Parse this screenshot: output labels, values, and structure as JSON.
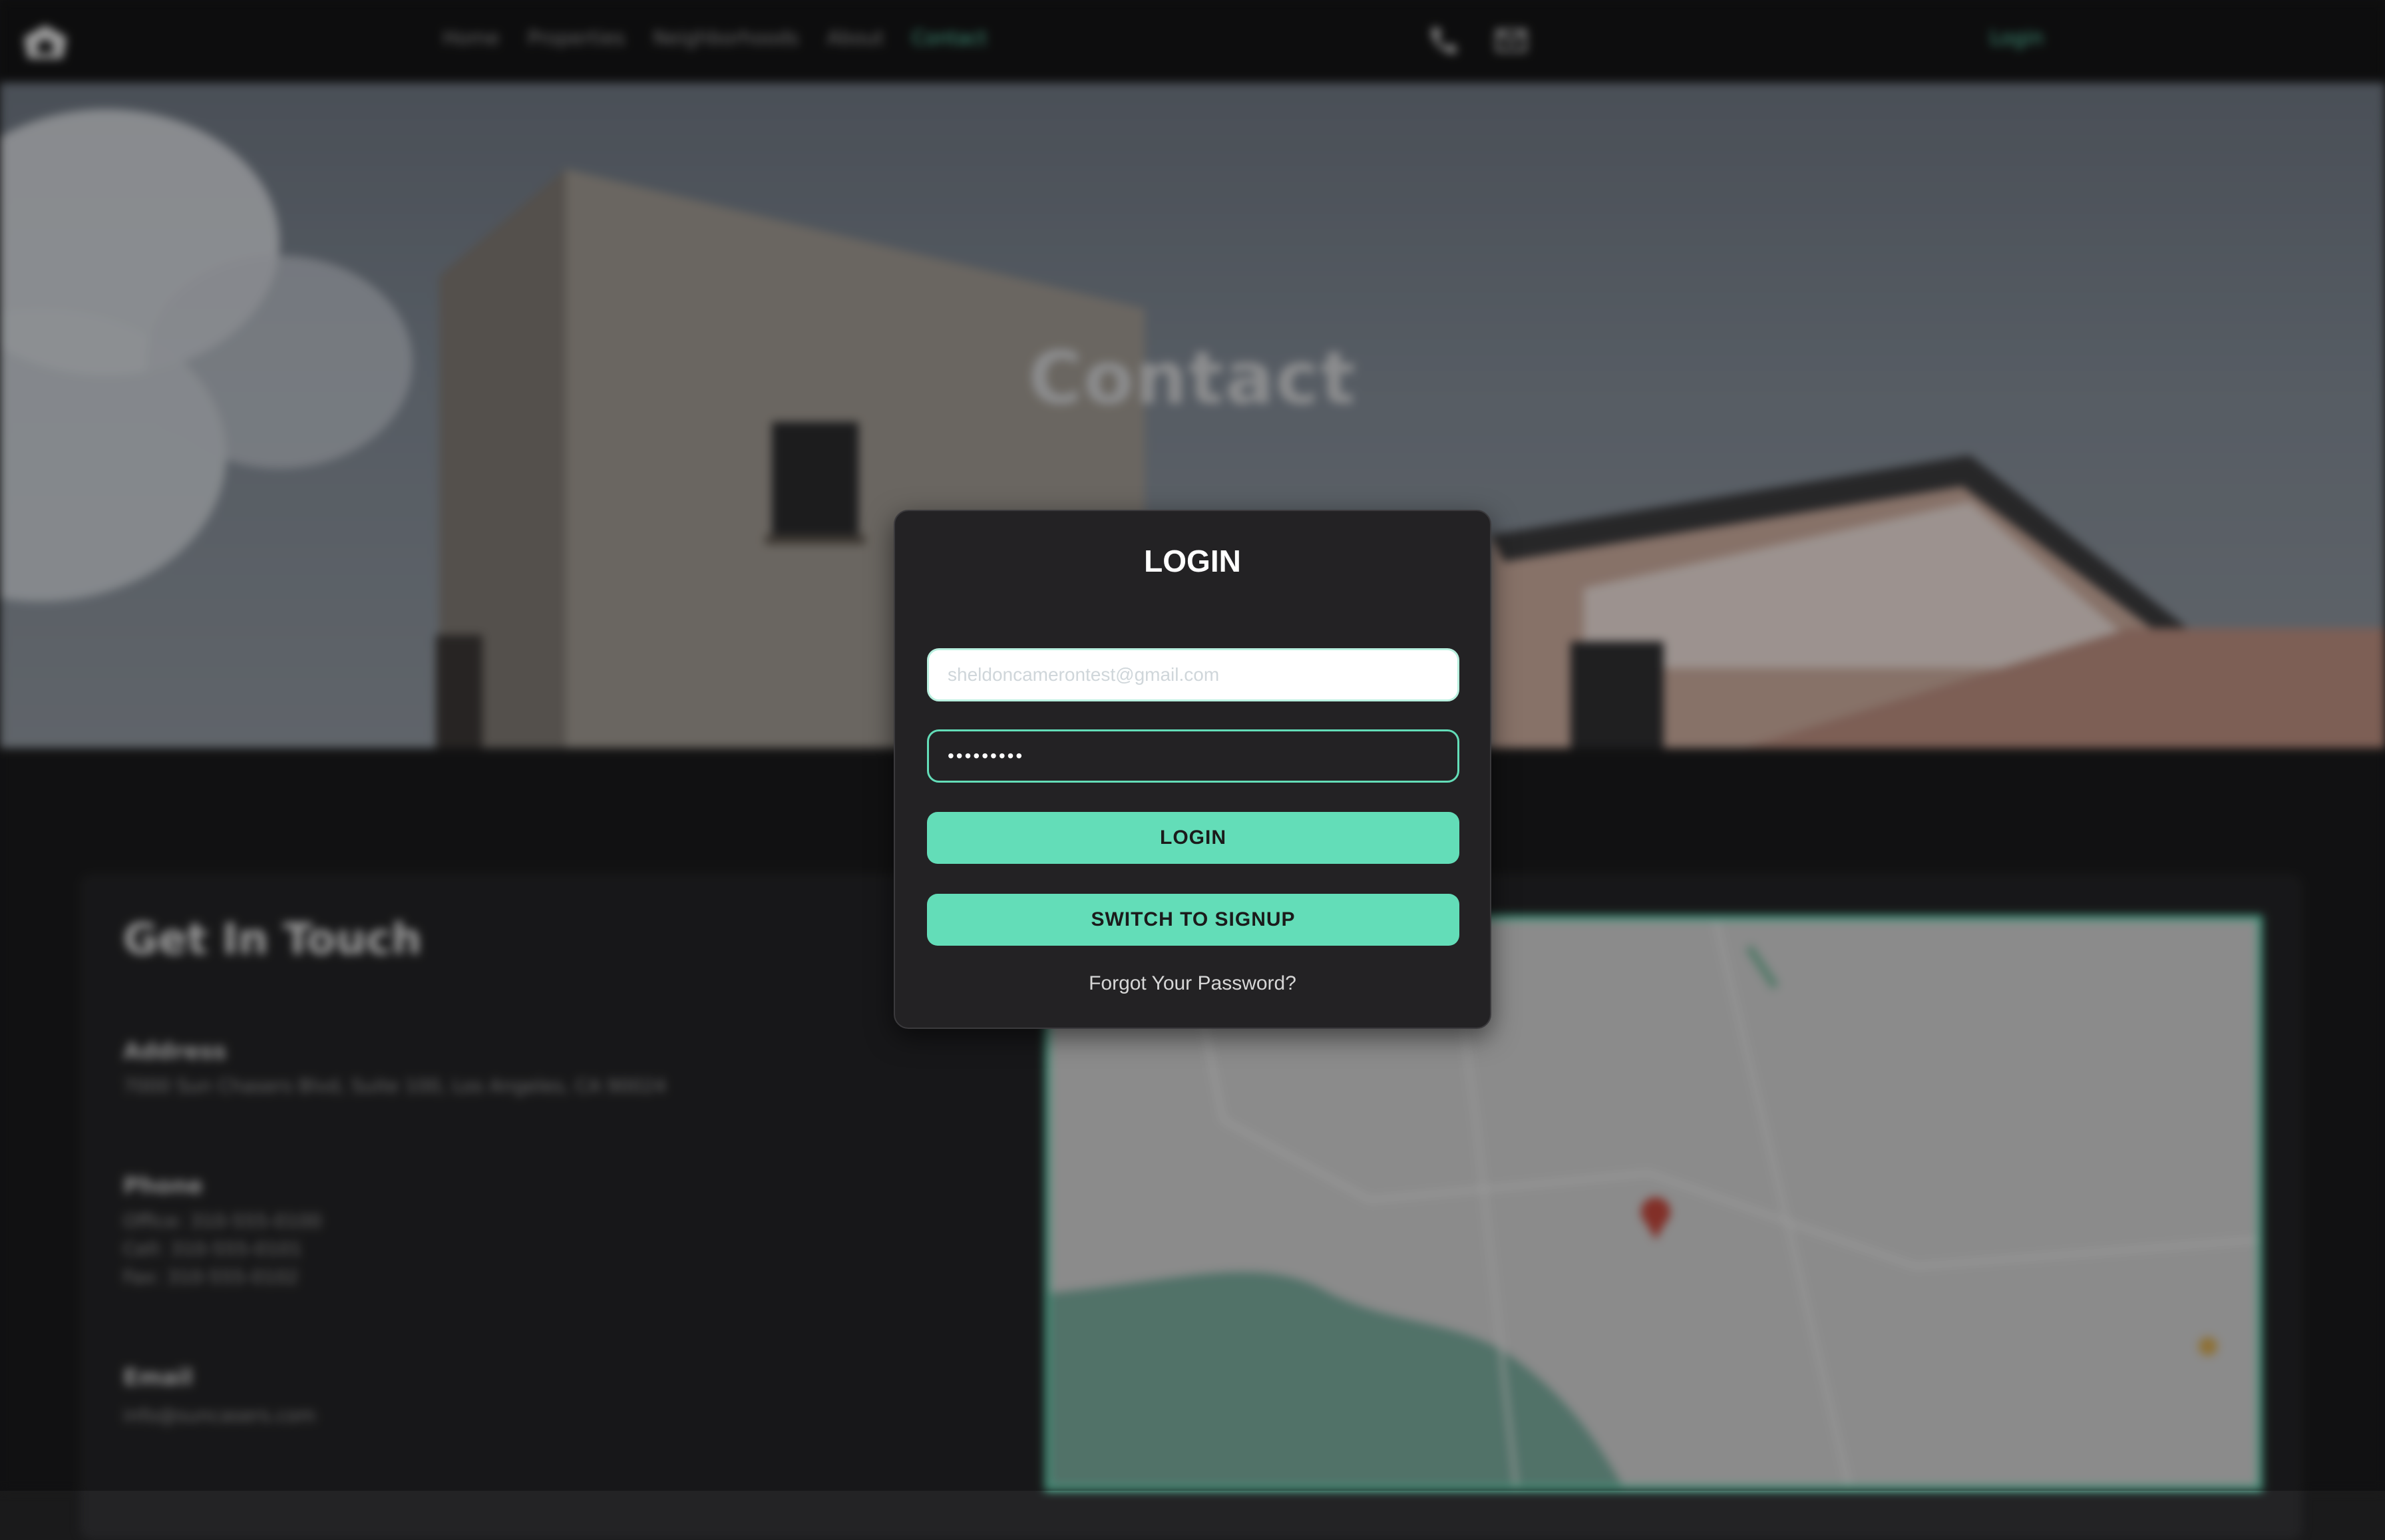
{
  "nav": {
    "links": [
      {
        "label": "Home"
      },
      {
        "label": "Properties"
      },
      {
        "label": "Neighborhoods"
      },
      {
        "label": "About"
      },
      {
        "label": "Contact"
      }
    ],
    "active_link": "Contact",
    "icons": [
      "phone-icon",
      "mail-icon"
    ],
    "login_label": "Login"
  },
  "hero": {
    "title": "Contact"
  },
  "contact": {
    "heading": "Get In Touch",
    "address_label": "Address",
    "address": "7000 Sun Chasers Blvd, Suite 100, Los Angeles, CA 90024",
    "phone_label": "Phone",
    "phones": [
      "Office: 310-555-0100",
      "Cell: 310-555-0101",
      "Fax: 310-555-0102"
    ],
    "email_label": "Email",
    "email": "info@suncasers.com"
  },
  "modal": {
    "title": "LOGIN",
    "email_placeholder": "sheldoncamerontest@gmail.com",
    "password_value": "password1",
    "login_button": "LOGIN",
    "signup_button": "SWITCH TO SIGNUP",
    "forgot_link": "Forgot Your Password?"
  },
  "colors": {
    "accent": "#63ddb8",
    "modal_bg": "#232224",
    "page_bg": "#1a1a1b"
  }
}
